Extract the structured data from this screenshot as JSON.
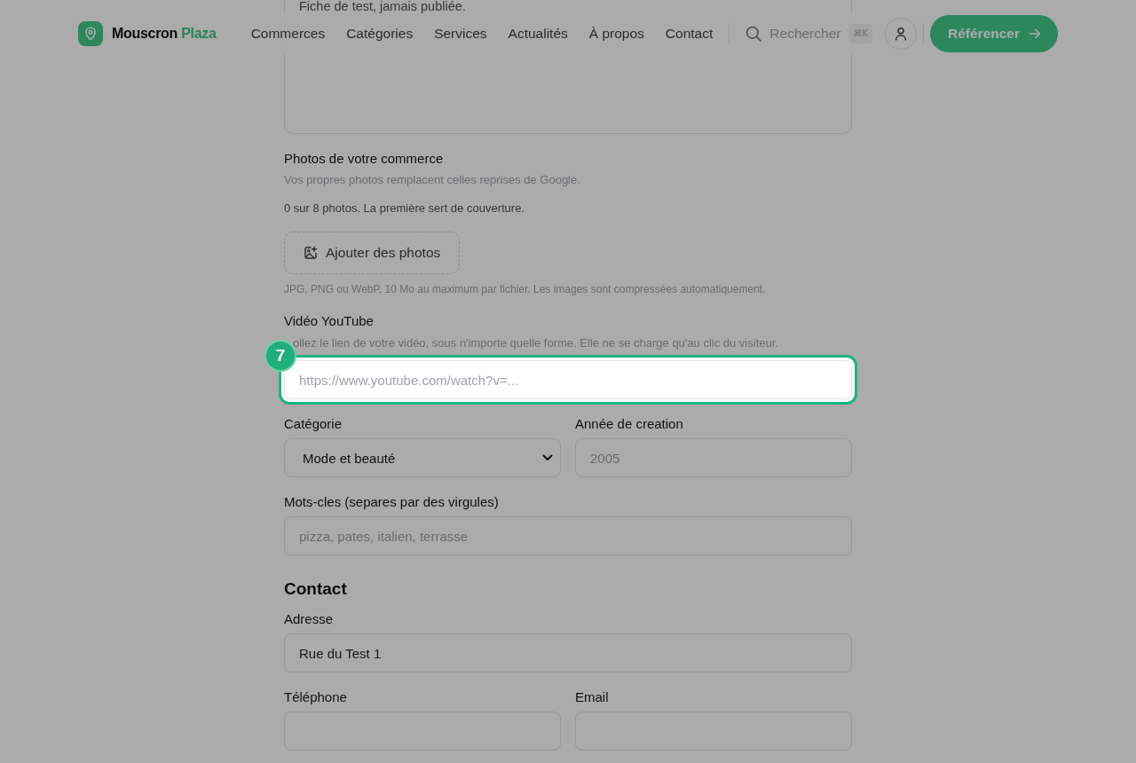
{
  "header": {
    "logo": {
      "name": "Mouscron",
      "accent": "Plaza"
    },
    "nav": [
      {
        "label": "Commerces"
      },
      {
        "label": "Catégories"
      },
      {
        "label": "Services"
      },
      {
        "label": "Actualités"
      },
      {
        "label": "À propos"
      },
      {
        "label": "Contact"
      }
    ],
    "search": {
      "label": "Rechercher",
      "shortcut": "⌘K"
    },
    "cta": {
      "label": "Référencer"
    }
  },
  "tour": {
    "step": "7"
  },
  "form": [
    {
      "kind": "textarea",
      "value": "Fiche de test, jamais publiée."
    },
    {
      "kind": "photos",
      "label": "Photos de votre commerce",
      "help": "Vos propres photos remplacent celles reprises de Google.",
      "count": "0 sur 8 photos. La première sert de couverture.",
      "button": "Ajouter des photos",
      "hint": "JPG, PNG ou WebP, 10 Mo au maximum par fichier. Les images sont compressées automatiquement."
    },
    {
      "kind": "fields",
      "fields": [
        {
          "kind": "input",
          "label": "Vidéo YouTube",
          "help": "ollez le lien de votre vidéo, sous n'importe quelle forme. Elle ne se charge qu'au clic du visiteur.",
          "placeholder": "https://www.youtube.com/watch?v=...",
          "highlighted": true
        }
      ]
    },
    {
      "kind": "fields",
      "fields": [
        {
          "kind": "select",
          "label": "Catégorie",
          "value": "Mode et beauté",
          "highlighted": false
        },
        {
          "kind": "input",
          "label": "Année de creation",
          "placeholder": "2005",
          "highlighted": false
        }
      ]
    },
    {
      "kind": "fields",
      "fields": [
        {
          "kind": "input",
          "label": "Mots-cles (separes par des virgules)",
          "placeholder": "pizza, pates, italien, terrasse",
          "highlighted": false
        }
      ]
    },
    {
      "kind": "heading",
      "text": "Contact"
    },
    {
      "kind": "fields",
      "fields": [
        {
          "kind": "input",
          "label": "Adresse",
          "value": "Rue du Test 1",
          "highlighted": false
        }
      ]
    },
    {
      "kind": "fields",
      "fields": [
        {
          "kind": "input",
          "label": "Téléphone",
          "highlighted": false
        },
        {
          "kind": "input",
          "label": "Email",
          "highlighted": false
        }
      ]
    }
  ]
}
